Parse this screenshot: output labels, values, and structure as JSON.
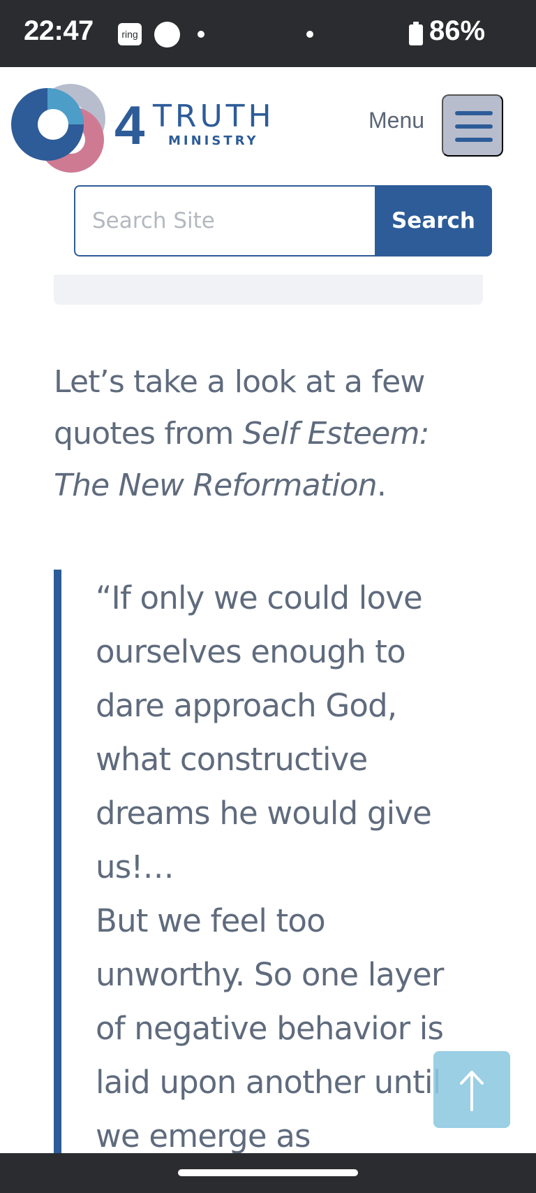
{
  "status_bar": {
    "time": "22:47",
    "ring_app_label": "ring",
    "battery_percent": "86%"
  },
  "header": {
    "logo": {
      "number": "4",
      "word": "TRUTH",
      "sub": "MINISTRY",
      "colors": {
        "blue": "#2d5c98",
        "light_blue": "#4c9ec9",
        "gray": "#b7bdcd",
        "pink": "#cf7a93"
      }
    },
    "menu_label": "Menu",
    "menu_icon": "hamburger-icon"
  },
  "search": {
    "placeholder": "Search Site",
    "value": "",
    "button_label": "Search"
  },
  "article": {
    "intro_before": "Let’s take a look at a few quotes from ",
    "intro_title": "Self Esteem: The New Reformation",
    "intro_after": ".",
    "quote_lines": [
      "“If only we could love",
      "ourselves enough to",
      "dare approach God,",
      "what constructive",
      "dreams he would give",
      "us!…",
      "But we feel too",
      "unworthy. So one layer",
      "of negative behavior is",
      "laid upon another until",
      "we emerge as"
    ]
  },
  "back_to_top": {
    "icon": "arrow-up-icon"
  },
  "colors": {
    "accent": "#2d5c98",
    "text": "#5f6b7d",
    "system_bar": "#2b2c30"
  }
}
